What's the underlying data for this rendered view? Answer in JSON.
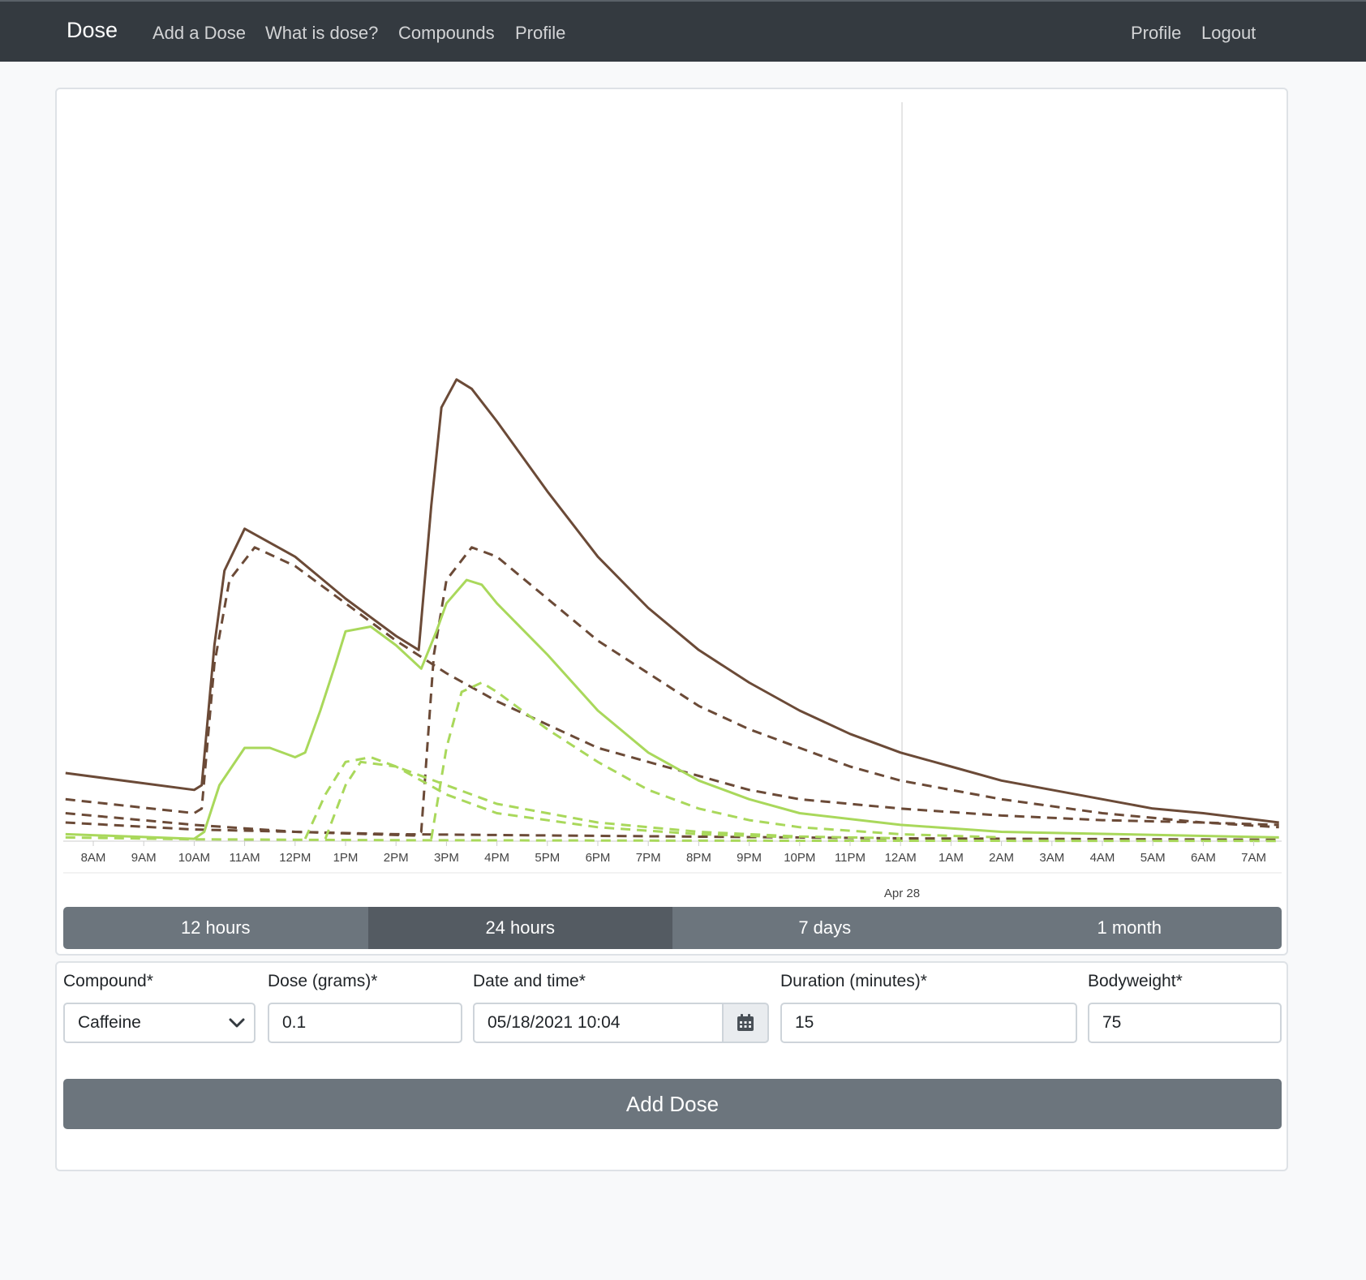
{
  "nav": {
    "brand": "Dose",
    "links": [
      "Add a Dose",
      "What is dose?",
      "Compounds",
      "Profile"
    ],
    "right_links": [
      "Profile",
      "Logout"
    ]
  },
  "chart_data": {
    "type": "line",
    "x_ticks": [
      "8AM",
      "9AM",
      "10AM",
      "11AM",
      "12PM",
      "1PM",
      "2PM",
      "3PM",
      "4PM",
      "5PM",
      "6PM",
      "7PM",
      "8PM",
      "9PM",
      "10PM",
      "11PM",
      "12AM",
      "1AM",
      "2AM",
      "3AM",
      "4AM",
      "5AM",
      "6AM",
      "7AM"
    ],
    "date_label": "Apr 28",
    "x_unit": "hour of Apr 27 (24 = 12AM Apr 28)",
    "colors": {
      "brown": "#6b4a37",
      "green": "#a9d85b"
    },
    "series": [
      {
        "color": "#6b4a37",
        "dashed": false,
        "points": [
          [
            7.45,
            0.146
          ],
          [
            10,
            0.11
          ],
          [
            10.15,
            0.12
          ],
          [
            10.4,
            0.42
          ],
          [
            10.6,
            0.58
          ],
          [
            11,
            0.67
          ],
          [
            12,
            0.61
          ],
          [
            13,
            0.52
          ],
          [
            14,
            0.44
          ],
          [
            14.45,
            0.41
          ],
          [
            14.7,
            0.72
          ],
          [
            14.9,
            0.93
          ],
          [
            15.2,
            0.99
          ],
          [
            15.5,
            0.97
          ],
          [
            16,
            0.9
          ],
          [
            17,
            0.75
          ],
          [
            18,
            0.61
          ],
          [
            19,
            0.5
          ],
          [
            20,
            0.41
          ],
          [
            21,
            0.34
          ],
          [
            22,
            0.28
          ],
          [
            23,
            0.23
          ],
          [
            24,
            0.19
          ],
          [
            25,
            0.16
          ],
          [
            26,
            0.13
          ],
          [
            27,
            0.11
          ],
          [
            28,
            0.09
          ],
          [
            29,
            0.07
          ],
          [
            30,
            0.06
          ],
          [
            31.5,
            0.04
          ]
        ]
      },
      {
        "color": "#6b4a37",
        "dashed": true,
        "points": [
          [
            7.45,
            0.09
          ],
          [
            10,
            0.06
          ],
          [
            10.15,
            0.07
          ],
          [
            10.4,
            0.38
          ],
          [
            10.7,
            0.56
          ],
          [
            11.2,
            0.63
          ],
          [
            12,
            0.59
          ],
          [
            13,
            0.51
          ],
          [
            14,
            0.43
          ],
          [
            15,
            0.36
          ],
          [
            16,
            0.3
          ],
          [
            17,
            0.25
          ],
          [
            18,
            0.2
          ],
          [
            19,
            0.17
          ],
          [
            20,
            0.14
          ],
          [
            21,
            0.11
          ],
          [
            22,
            0.09
          ],
          [
            24,
            0.07
          ],
          [
            26,
            0.055
          ],
          [
            28,
            0.045
          ],
          [
            30,
            0.04
          ],
          [
            31.5,
            0.035
          ]
        ]
      },
      {
        "color": "#6b4a37",
        "dashed": true,
        "points": [
          [
            7.45,
            0.06
          ],
          [
            10,
            0.035
          ],
          [
            12,
            0.02
          ],
          [
            14.4,
            0.012
          ],
          [
            14.5,
            0.02
          ],
          [
            14.75,
            0.4
          ],
          [
            15,
            0.56
          ],
          [
            15.5,
            0.63
          ],
          [
            16,
            0.61
          ],
          [
            17,
            0.52
          ],
          [
            18,
            0.43
          ],
          [
            19,
            0.36
          ],
          [
            20,
            0.29
          ],
          [
            21,
            0.24
          ],
          [
            22,
            0.2
          ],
          [
            23,
            0.16
          ],
          [
            24,
            0.13
          ],
          [
            25,
            0.11
          ],
          [
            26,
            0.09
          ],
          [
            28,
            0.06
          ],
          [
            30,
            0.04
          ],
          [
            31.5,
            0.03
          ]
        ]
      },
      {
        "color": "#6b4a37",
        "dashed": true,
        "points": [
          [
            7.45,
            0.04
          ],
          [
            10,
            0.025
          ],
          [
            14,
            0.015
          ],
          [
            24,
            0.006
          ],
          [
            31.5,
            0.003
          ]
        ]
      },
      {
        "color": "#a9d85b",
        "dashed": false,
        "points": [
          [
            7.45,
            0.015
          ],
          [
            10,
            0.005
          ],
          [
            10.2,
            0.02
          ],
          [
            10.5,
            0.12
          ],
          [
            11,
            0.2
          ],
          [
            11.5,
            0.2
          ],
          [
            12,
            0.18
          ],
          [
            12.2,
            0.19
          ],
          [
            12.5,
            0.28
          ],
          [
            12.8,
            0.38
          ],
          [
            13,
            0.45
          ],
          [
            13.5,
            0.46
          ],
          [
            14,
            0.42
          ],
          [
            14.5,
            0.37
          ],
          [
            14.8,
            0.45
          ],
          [
            15,
            0.51
          ],
          [
            15.4,
            0.56
          ],
          [
            15.7,
            0.55
          ],
          [
            16,
            0.51
          ],
          [
            17,
            0.4
          ],
          [
            18,
            0.28
          ],
          [
            19,
            0.19
          ],
          [
            20,
            0.13
          ],
          [
            21,
            0.09
          ],
          [
            22,
            0.06
          ],
          [
            24,
            0.035
          ],
          [
            26,
            0.02
          ],
          [
            31.5,
            0.008
          ]
        ]
      },
      {
        "color": "#a9d85b",
        "dashed": true,
        "points": [
          [
            12.2,
            0.005
          ],
          [
            12.6,
            0.1
          ],
          [
            13,
            0.17
          ],
          [
            13.5,
            0.18
          ],
          [
            14,
            0.16
          ],
          [
            15,
            0.12
          ],
          [
            16,
            0.08
          ],
          [
            17,
            0.06
          ],
          [
            18,
            0.04
          ],
          [
            20,
            0.02
          ],
          [
            22,
            0.01
          ],
          [
            24,
            0.006
          ]
        ]
      },
      {
        "color": "#a9d85b",
        "dashed": true,
        "points": [
          [
            12.6,
            0.005
          ],
          [
            13,
            0.12
          ],
          [
            13.3,
            0.17
          ],
          [
            14,
            0.16
          ],
          [
            15,
            0.1
          ],
          [
            16,
            0.06
          ],
          [
            18,
            0.03
          ],
          [
            20,
            0.015
          ],
          [
            22,
            0.008
          ]
        ]
      },
      {
        "color": "#a9d85b",
        "dashed": true,
        "points": [
          [
            14.7,
            0.005
          ],
          [
            15,
            0.2
          ],
          [
            15.3,
            0.32
          ],
          [
            15.7,
            0.34
          ],
          [
            16,
            0.32
          ],
          [
            17,
            0.24
          ],
          [
            18,
            0.17
          ],
          [
            19,
            0.11
          ],
          [
            20,
            0.07
          ],
          [
            21,
            0.045
          ],
          [
            22,
            0.03
          ],
          [
            24,
            0.015
          ],
          [
            26,
            0.008
          ]
        ]
      },
      {
        "color": "#a9d85b",
        "dashed": true,
        "points": [
          [
            7.45,
            0.008
          ],
          [
            10,
            0.004
          ],
          [
            14,
            0.002
          ],
          [
            20,
            0.001
          ],
          [
            31.5,
            0.0005
          ]
        ]
      }
    ]
  },
  "range_buttons": [
    "12 hours",
    "24 hours",
    "7 days",
    "1 month"
  ],
  "active_range": "24 hours",
  "form": {
    "compound": {
      "label": "Compound*",
      "value": "Caffeine"
    },
    "dose": {
      "label": "Dose (grams)*",
      "value": "0.1"
    },
    "datetime": {
      "label": "Date and time*",
      "value": "05/18/2021 10:04"
    },
    "duration": {
      "label": "Duration (minutes)*",
      "value": "15"
    },
    "bodyweight": {
      "label": "Bodyweight*",
      "value": "75"
    },
    "submit_label": "Add Dose"
  }
}
